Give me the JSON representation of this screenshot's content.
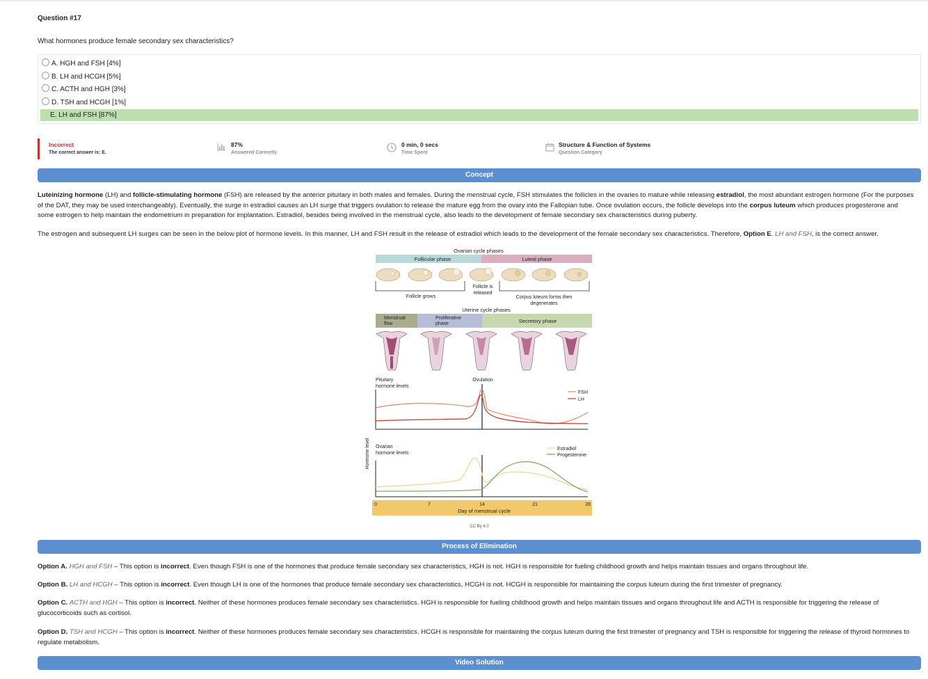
{
  "question": {
    "number": "Question #17",
    "text": "What hormones produce female secondary sex characteristics?",
    "options": [
      {
        "label": "A. HGH and FSH [4%]",
        "correct": false
      },
      {
        "label": "B. LH and HCGH [5%]",
        "correct": false
      },
      {
        "label": "C. ACTH and HGH [3%]",
        "correct": false
      },
      {
        "label": "D. TSH and HCGH [1%]",
        "correct": false
      },
      {
        "label": "E. LH and FSH [87%]",
        "correct": true
      }
    ]
  },
  "result": {
    "status": "Incorrect",
    "correct_answer": "The correct answer is: E.",
    "percent": "87%",
    "percent_label": "Answered Correctly",
    "time": "0 min, 0 secs",
    "time_label": "Time Spent",
    "category": "Structure & Function of Systems",
    "category_label": "Question Category"
  },
  "concept": {
    "heading": "Concept",
    "p1": {
      "b1": "Luteinizing hormone",
      "t1": " (LH) and ",
      "b2": "follicle-stimulating hormone",
      "t2": " (FSH) are released by the anterior pituitary in both males and females. During the menstrual cycle, FSH stimulates the follicles in the ovaries to mature while releasing ",
      "b3": "estradiol",
      "t3": ", the most abundant estrogen hormone (For the purposes of the DAT, they may be used interchangeably). Eventually, the surge in estradiol causes an LH surge that triggers ovulation to release the mature egg from the ovary into the Fallopian tube. Once ovulation occurs, the follicle develops into the ",
      "b4": "corpus luteum",
      "t4": " which produces progesterone and some estrogen to help maintain the endometrium in preparation for implantation. Estradiol, besides being involved in the menstrual cycle, also leads to the development of female secondary sex characteristics during puberty."
    },
    "p2": {
      "t1": "The estrogen and subsequent LH surges can be seen in the below plot of hormone levels. In this manner, LH and FSH result in the release of estradiol which leads to the development of the female secondary sex characteristics. Therefore, ",
      "b1": "Option E",
      "t2": ". ",
      "i1": "LH and FSH",
      "t3": ", is the correct answer."
    }
  },
  "figure": {
    "ovarian_title": "Ovarian cycle phases",
    "follicular": "Follicular phase",
    "luteal": "Luteal phase",
    "follicle_grows": "Follicle grows",
    "follicle_released_1": "Follicle is",
    "follicle_released_2": "released",
    "corpus_1": "Corpus luteum forms then",
    "corpus_2": "degenerates",
    "uterine_title": "Uterine cycle phases",
    "menstrual_1": "Menstrual",
    "menstrual_2": "flow",
    "proliferative_1": "Proliferative",
    "proliferative_2": "phase",
    "secretory": "Secretory phase",
    "pituitary_1": "Pituitary",
    "pituitary_2": "hormone levels",
    "ovulation": "Ovulation",
    "fsh": "FSH",
    "lh": "LH",
    "ovarian_1": "Ovarian",
    "ovarian_2": "hormone levels",
    "estradiol": "Estradiol",
    "progesterone": "Progesterone",
    "y_axis": "Hormone level",
    "ticks": [
      "0",
      "7",
      "14",
      "21",
      "28"
    ],
    "x_axis": "Day of menstrual cycle",
    "credit": "CC By 4.0"
  },
  "elimination": {
    "heading": "Process of Elimination",
    "a": {
      "opt": "Option A.",
      "ans": "HGH and FSH",
      "t1": " – This option is ",
      "inc": "incorrect",
      "t2": ". Even though FSH is one of the hormones that produce female secondary sex characteristics, HGH is not. HGH is responsible for fueling childhood growth and helps maintain tissues and organs throughout life."
    },
    "b": {
      "opt": "Option B.",
      "ans": "LH and HCGH",
      "t1": " – This option is ",
      "inc": "incorrect",
      "t2": ". Even though LH is one of the hormones that produce female secondary sex characteristics, HCGH is not. HCGH is responsible for maintaining the corpus luteum during the first trimester of pregnancy."
    },
    "c": {
      "opt": "Option C.",
      "ans": "ACTH and HGH",
      "t1": " – This option is ",
      "inc": "incorrect",
      "t2": ". Neither of these hormones produces female secondary sex characteristics. HGH is responsible for fueling childhood growth and helps maintain tissues and organs throughout life and ACTH is responsible for triggering the release of glucocorticoids such as cortisol."
    },
    "d": {
      "opt": "Option D.",
      "ans": "TSH and HCGH",
      "t1": " – This option is ",
      "inc": "incorrect",
      "t2": ". Neither of these hormones produces female secondary sex characteristics. HCGH is responsible for maintaining the corpus luteum during the first trimester of pregnancy and TSH is responsible for triggering the release of thyroid hormones to regulate metabolism."
    }
  },
  "video": {
    "heading": "Video Solution"
  },
  "colors": {
    "accent": "#5b8fd0",
    "correct_bg": "#bbe0ad",
    "incorrect": "#d62e2e"
  }
}
